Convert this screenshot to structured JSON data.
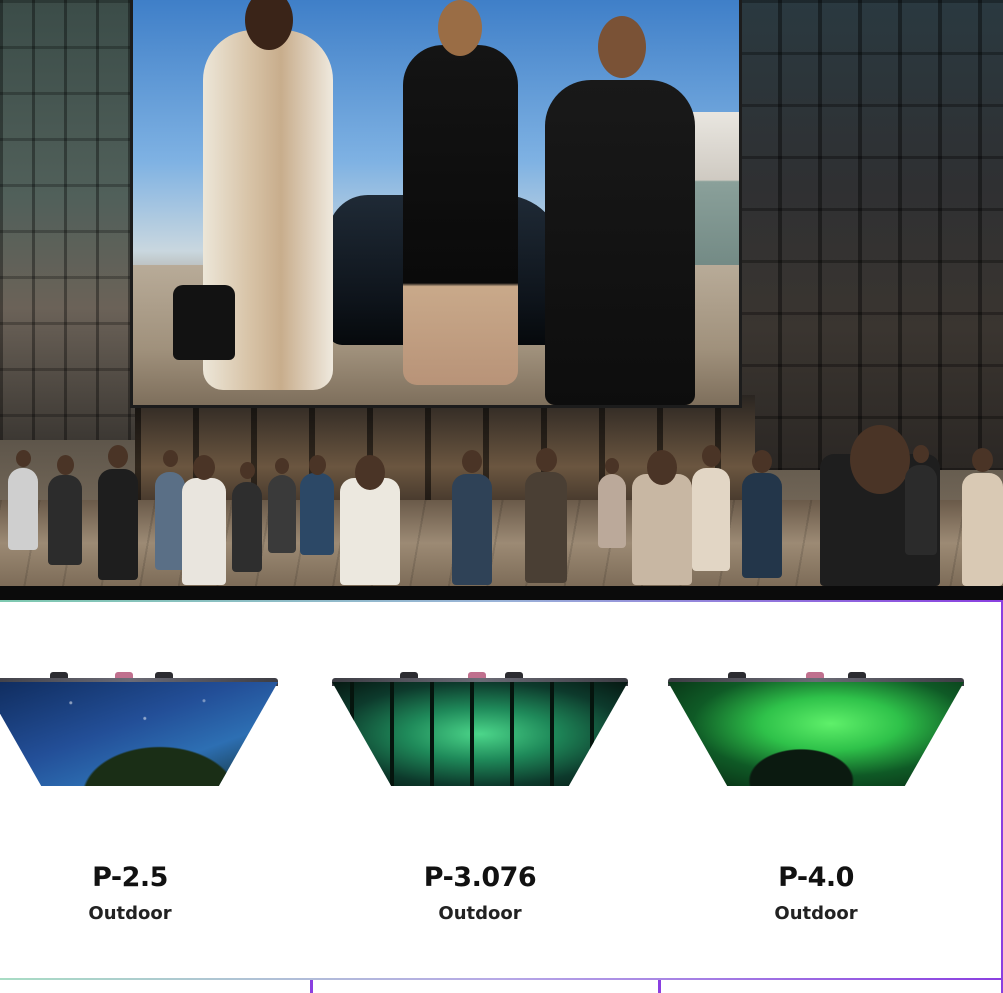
{
  "products": [
    {
      "name": "P-2.5",
      "type": "Outdoor",
      "preview_icon": "starry-night-panel-icon"
    },
    {
      "name": "P-3.076",
      "type": "Outdoor",
      "preview_icon": "aurora-forest-panel-icon"
    },
    {
      "name": "P-4.0",
      "type": "Outdoor",
      "preview_icon": "green-aurora-panel-icon"
    }
  ],
  "colors": {
    "accent_purple": "#8a3fe0",
    "accent_teal": "#7ec9b0",
    "text_dark": "#111111"
  }
}
